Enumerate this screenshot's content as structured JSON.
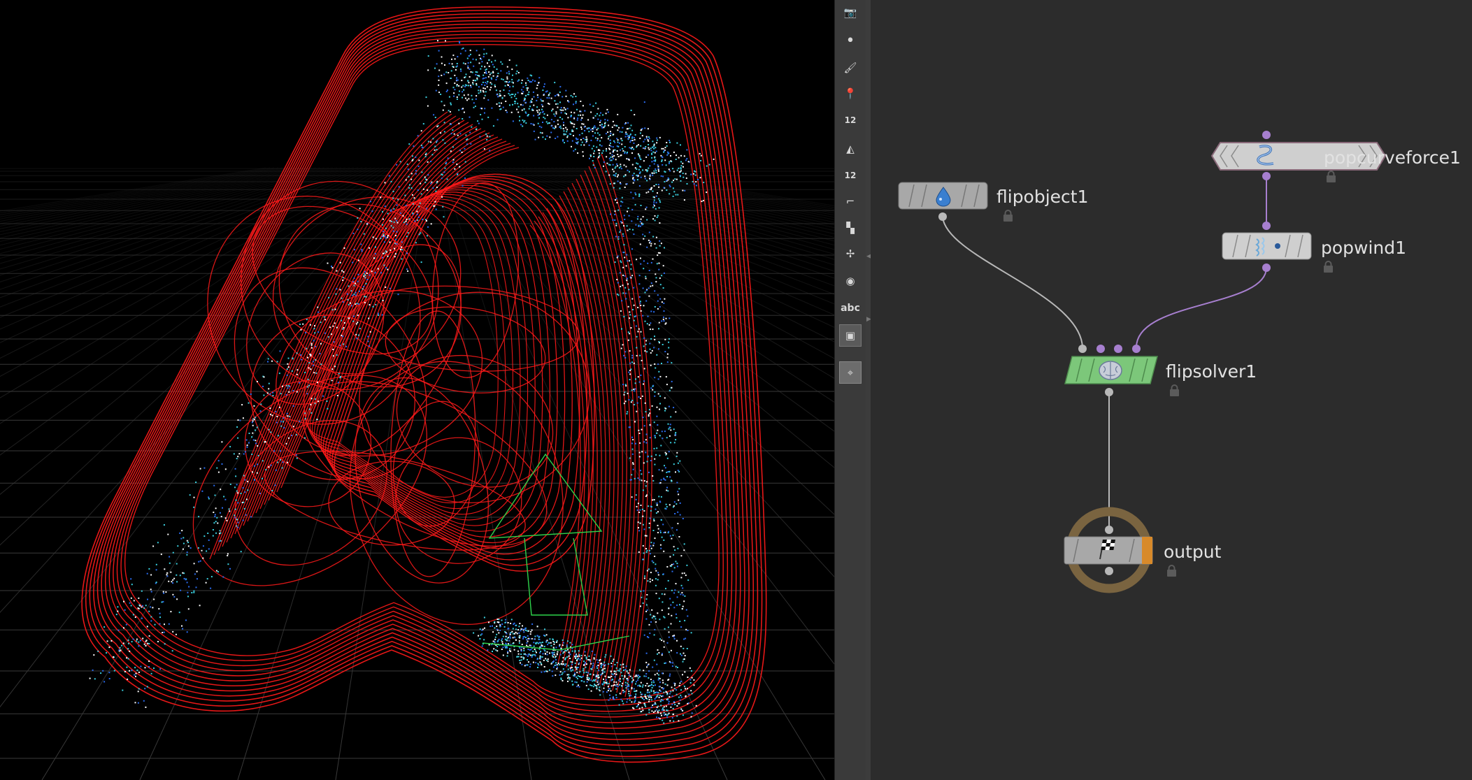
{
  "toolbar": {
    "tools": [
      {
        "icon": "view-camera-icon"
      },
      {
        "icon": "point-icon"
      },
      {
        "icon": "brush-icon"
      },
      {
        "icon": "pin-icon"
      },
      {
        "icon": "point-number-icon",
        "text": "12"
      },
      {
        "icon": "primitive-paint-icon"
      },
      {
        "icon": "primitive-number-icon",
        "text": "12"
      },
      {
        "icon": "normal-icon"
      },
      {
        "icon": "uv-checker-icon"
      },
      {
        "icon": "origin-icon"
      },
      {
        "icon": "wireframe-icon"
      },
      {
        "icon": "text-abc-icon",
        "text": "abc"
      },
      {
        "icon": "background-image-icon"
      },
      {
        "icon": "location-pin-icon"
      }
    ]
  },
  "network": {
    "nodes": [
      {
        "id": "flipobject1",
        "label": "flipobject1",
        "type": "flipobject",
        "icon": "droplet-icon",
        "color": "#a8a8a8",
        "locked": true
      },
      {
        "id": "popcurveforce1",
        "label": "popcurveforce1",
        "type": "popcurveforce",
        "icon": "curve-force-icon",
        "color": "#cfcfcf",
        "locked": true
      },
      {
        "id": "popwind1",
        "label": "popwind1",
        "type": "popwind",
        "icon": "wind-icon",
        "color": "#cfcfcf",
        "locked": true
      },
      {
        "id": "flipsolver1",
        "label": "flipsolver1",
        "type": "flipsolver",
        "icon": "brain-icon",
        "color": "#7cc77a",
        "locked": true
      },
      {
        "id": "output",
        "label": "output",
        "type": "output",
        "icon": "checkered-flag-icon",
        "color": "#a8a8a8",
        "flag_color": "#d88a2a",
        "ring_color": "#7a6440",
        "locked": true
      }
    ],
    "wire_colors": {
      "object": "#b8b8b8",
      "force": "#a77fcf"
    }
  },
  "viewport": {
    "background_color": "#000000",
    "grid_color": "#3a3a3a",
    "curve_color": "#ff1a1a",
    "particle_colors": [
      "#ffffff",
      "#3ad0e0",
      "#2a6cf0"
    ],
    "guide_color": "#2ed24a"
  }
}
